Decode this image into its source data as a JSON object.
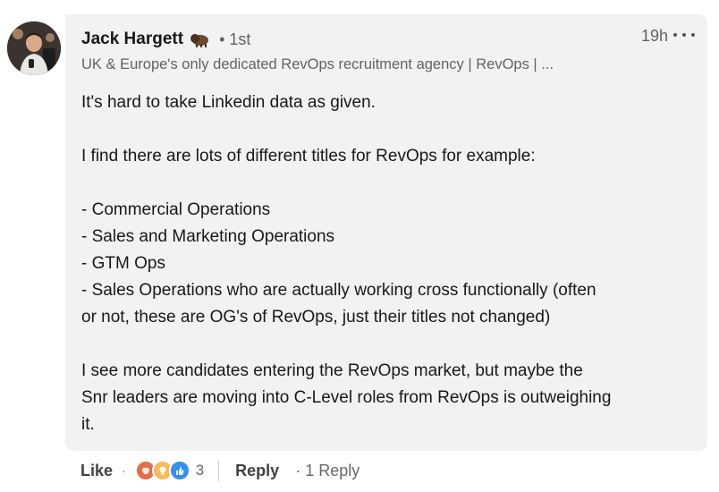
{
  "comment": {
    "author_name": "Jack Hargett",
    "author_badge_icon": "bison-icon",
    "connection_degree": "• 1st",
    "timestamp": "19h",
    "headline": "UK & Europe's only dedicated RevOps recruitment agency | RevOps | ...",
    "paragraphs": [
      [
        "It's hard to take Linkedin data as given."
      ],
      [
        "I find there are lots of different titles for RevOps for example:"
      ],
      [
        "- Commercial Operations",
        "- Sales and Marketing Operations",
        "- GTM Ops",
        "- Sales Operations who are actually working cross functionally (often",
        "or not, these are OG's of RevOps, just their titles not changed)"
      ],
      [
        "I see more candidates entering the RevOps market, but maybe the",
        "Snr leaders are moving into C-Level roles from RevOps is outweighing",
        "it."
      ]
    ]
  },
  "actions": {
    "like_label": "Like",
    "separator": "·",
    "reaction_icons": [
      "celebrate-icon",
      "insightful-icon",
      "like-icon"
    ],
    "reaction_count": "3",
    "reply_label": "Reply",
    "reply_count_label": "· 1 Reply"
  },
  "colors": {
    "bubble_bg": "#f2f2f2",
    "celebrate": "#df704d",
    "insightful": "#f5bb5c",
    "like": "#378fe9"
  }
}
